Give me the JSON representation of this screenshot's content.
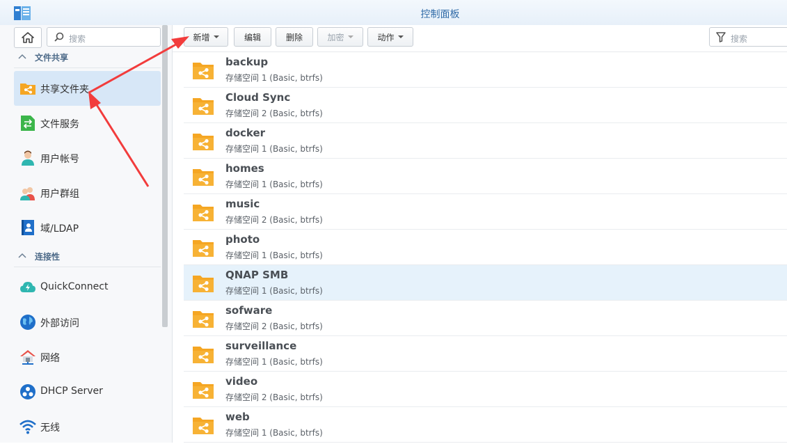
{
  "window": {
    "title": "控制面板"
  },
  "sidebar": {
    "search_placeholder": "搜索",
    "sections": [
      {
        "label": "文件共享"
      },
      {
        "label": "连接性"
      }
    ],
    "items": [
      {
        "label": "共享文件夹",
        "icon": "shared-folder-icon",
        "active": true
      },
      {
        "label": "文件服务",
        "icon": "file-services-icon"
      },
      {
        "label": "用户帐号",
        "icon": "user-icon"
      },
      {
        "label": "用户群组",
        "icon": "group-icon"
      },
      {
        "label": "域/LDAP",
        "icon": "ldap-icon"
      },
      {
        "label": "QuickConnect",
        "icon": "quickconnect-icon"
      },
      {
        "label": "外部访问",
        "icon": "globe-icon"
      },
      {
        "label": "网络",
        "icon": "network-house-icon"
      },
      {
        "label": "DHCP Server",
        "icon": "dhcp-icon"
      },
      {
        "label": "无线",
        "icon": "wifi-icon"
      }
    ]
  },
  "toolbar": {
    "new_label": "新增",
    "edit_label": "编辑",
    "delete_label": "删除",
    "encrypt_label": "加密",
    "action_label": "动作",
    "filter_placeholder": "搜索"
  },
  "folders": [
    {
      "name": "backup",
      "detail": "存储空间 1 (Basic, btrfs)"
    },
    {
      "name": "Cloud Sync",
      "detail": "存储空间 2 (Basic, btrfs)"
    },
    {
      "name": "docker",
      "detail": "存储空间 1 (Basic, btrfs)"
    },
    {
      "name": "homes",
      "detail": "存储空间 1 (Basic, btrfs)"
    },
    {
      "name": "music",
      "detail": "存储空间 2 (Basic, btrfs)"
    },
    {
      "name": "photo",
      "detail": "存储空间 1 (Basic, btrfs)"
    },
    {
      "name": "QNAP SMB",
      "detail": "存储空间 1 (Basic, btrfs)",
      "selected": true
    },
    {
      "name": "sofware",
      "detail": "存储空间 2 (Basic, btrfs)"
    },
    {
      "name": "surveillance",
      "detail": "存储空间 1 (Basic, btrfs)"
    },
    {
      "name": "video",
      "detail": "存储空间 2 (Basic, btrfs)"
    },
    {
      "name": "web",
      "detail": "存储空间 1 (Basic, btrfs)"
    }
  ],
  "colors": {
    "accent": "#2f6aa7",
    "folder": "#f5a623",
    "annotation_arrow": "#f23c3c",
    "selected_row": "#e6f2fb",
    "active_nav": "#d7e7f7"
  }
}
